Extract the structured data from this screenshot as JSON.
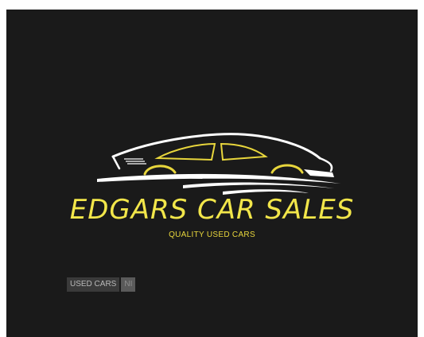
{
  "brand": {
    "name": "EDGARS CAR SALES",
    "tagline": "QUALITY USED CARS",
    "logo_icon": "car-silhouette-icon",
    "colors": {
      "background": "#1a1a1a",
      "accent": "#f2e64a",
      "car_lines": "#ffffff"
    }
  },
  "badge": {
    "label": "USED CARS",
    "region": "NI"
  }
}
